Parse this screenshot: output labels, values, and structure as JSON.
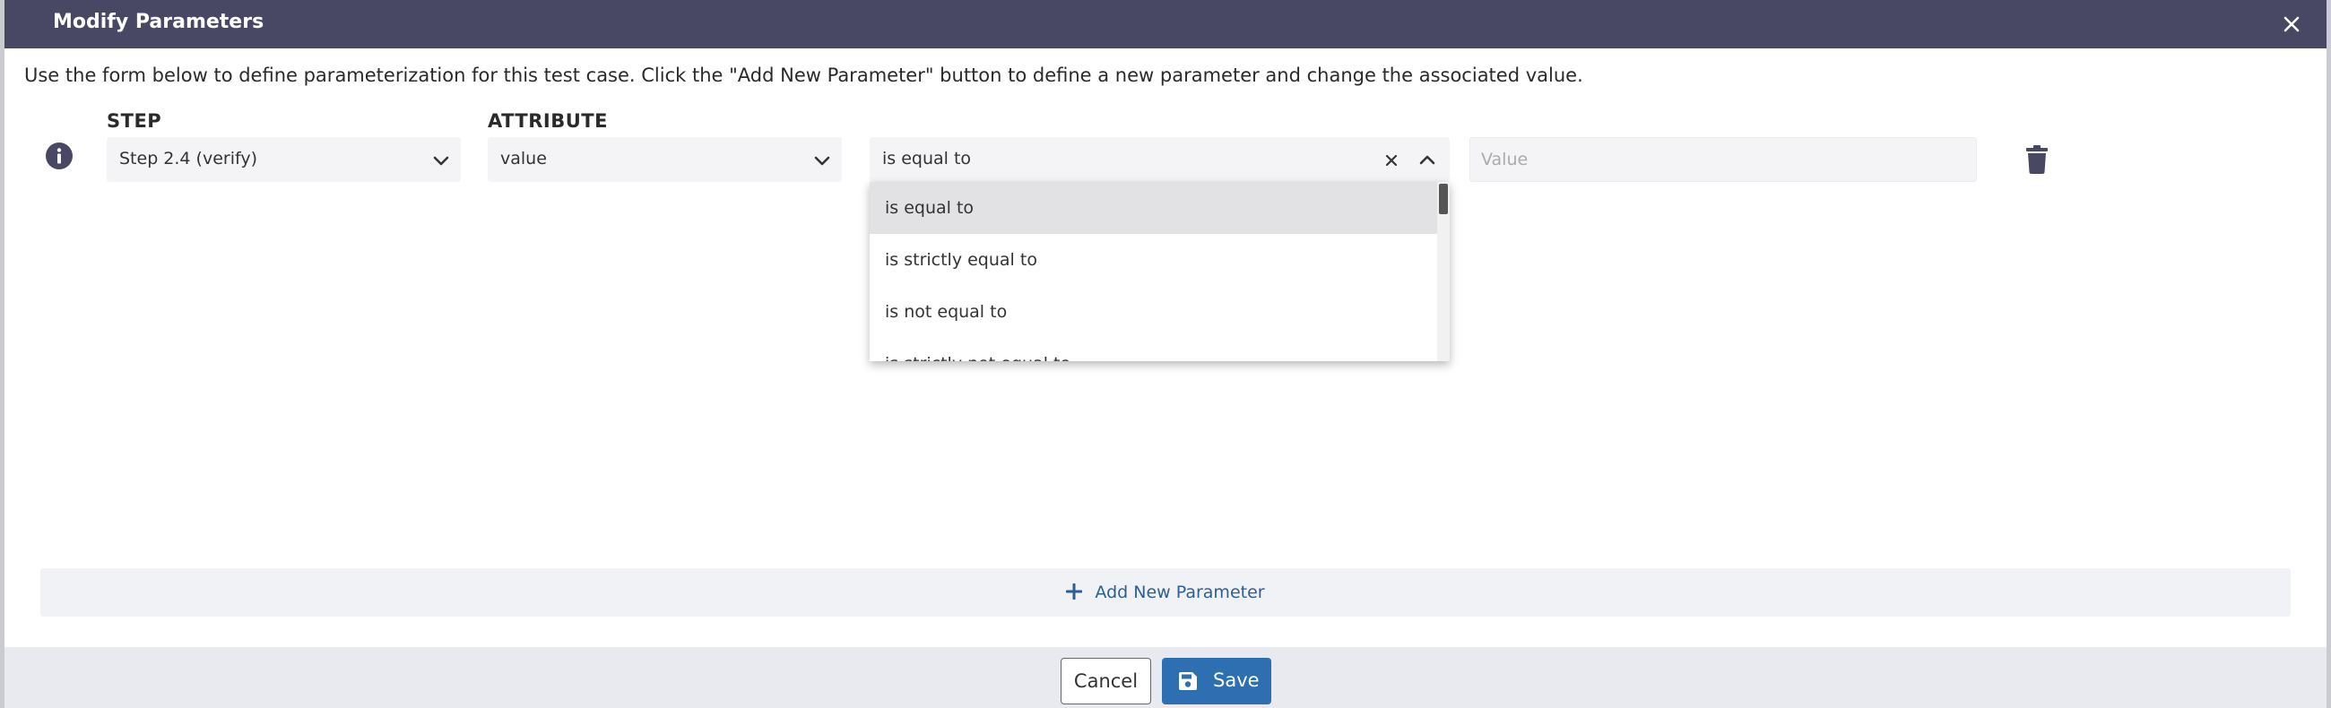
{
  "modal": {
    "title": "Modify Parameters",
    "description": "Use the form below to define parameterization for this test case. Click the \"Add New Parameter\" button to define a new parameter and change the associated value."
  },
  "columns": {
    "step_label": "STEP",
    "attribute_label": "ATTRIBUTE"
  },
  "row": {
    "step_value": "Step 2.4 (verify)",
    "attribute_value": "value",
    "operator_value": "is equal to",
    "value_placeholder": "Value"
  },
  "operator_dropdown": {
    "options": [
      "is equal to",
      "is strictly equal to",
      "is not equal to",
      "is strictly not equal to"
    ],
    "selected_index": 0
  },
  "add_parameter": {
    "label": "Add New Parameter"
  },
  "footer": {
    "cancel_label": "Cancel",
    "save_label": "Save"
  },
  "colors": {
    "header_bg": "#484865",
    "primary": "#2d6fb0",
    "link": "#2c5f94",
    "field_bg": "#f4f4f6",
    "footer_bg": "#e8eaf0"
  },
  "icons": [
    "close-icon",
    "info-icon",
    "chevron-down-icon",
    "chevron-up-icon",
    "clear-icon",
    "trash-icon",
    "plus-icon",
    "save-icon"
  ]
}
